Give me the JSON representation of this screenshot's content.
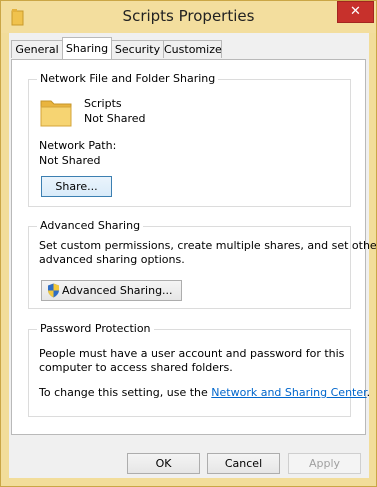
{
  "window": {
    "title": "Scripts Properties",
    "close_glyph": "✕"
  },
  "tabs": [
    {
      "label": "General"
    },
    {
      "label": "Sharing"
    },
    {
      "label": "Security"
    },
    {
      "label": "Customize"
    }
  ],
  "network_sharing": {
    "title": "Network File and Folder Sharing",
    "folder_name": "Scripts",
    "folder_status": "Not Shared",
    "path_label": "Network Path:",
    "path_value": "Not Shared",
    "share_button": "Share..."
  },
  "advanced_sharing": {
    "title": "Advanced Sharing",
    "description_line1": "Set custom permissions, create multiple shares, and set other",
    "description_line2": "advanced sharing options.",
    "button_label": "Advanced Sharing..."
  },
  "password_protection": {
    "title": "Password Protection",
    "line1": "People must have a user account and password for this",
    "line2": "computer to access shared folders.",
    "change_prefix": "To change this setting, use the ",
    "link_text": "Network and Sharing Center",
    "change_suffix": "."
  },
  "footer": {
    "ok": "OK",
    "cancel": "Cancel",
    "apply": "Apply"
  },
  "colors": {
    "frame": "#f2dd9a",
    "close": "#c7312c",
    "link": "#0066cc"
  },
  "icons": [
    "folder-icon",
    "shield-icon",
    "close-icon"
  ]
}
